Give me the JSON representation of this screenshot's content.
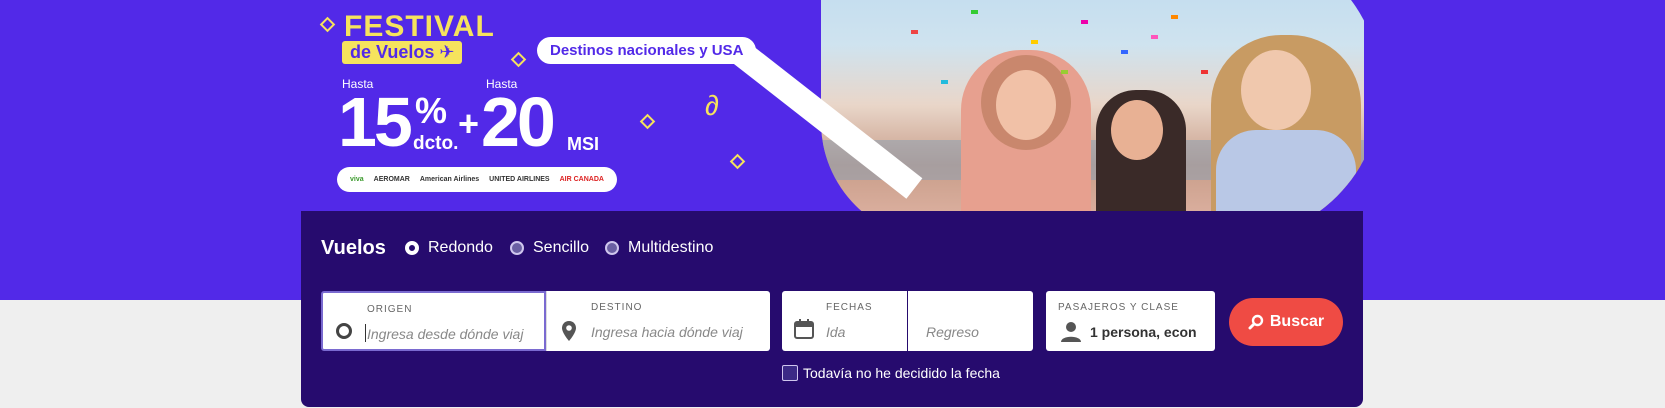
{
  "banner": {
    "festival": "FESTIVAL",
    "de_vuelos": "de Vuelos",
    "destinos": "Destinos nacionales y USA",
    "hasta_1": "Hasta",
    "hasta_2": "Hasta",
    "big_15": "15",
    "percent": "%",
    "dcto": "dcto.",
    "plus": "+",
    "big_20": "20",
    "msi": "MSI",
    "airlines": [
      "viva",
      "AEROMAR",
      "American Airlines",
      "UNITED AIRLINES",
      "AIR CANADA"
    ]
  },
  "search": {
    "title": "Vuelos",
    "trip_types": [
      "Redondo",
      "Sencillo",
      "Multidestino"
    ],
    "selected_trip_type": "Redondo",
    "origin_label": "ORIGEN",
    "origin_placeholder": "Ingresa desde dónde viaj",
    "dest_label": "DESTINO",
    "dest_placeholder": "Ingresa hacia dónde viaj",
    "dates_label": "FECHAS",
    "ida_placeholder": "Ida",
    "regreso_placeholder": "Regreso",
    "pax_label": "PASAJEROS Y CLASE",
    "pax_value": "1 persona, econ",
    "search_button": "Buscar",
    "undecided_label": "Todavía no he decidido la fecha"
  },
  "colors": {
    "brand_purple": "#5229e8",
    "panel": "#260b6e",
    "accent_yellow": "#f6e35d",
    "button_red": "#ef4b44"
  }
}
